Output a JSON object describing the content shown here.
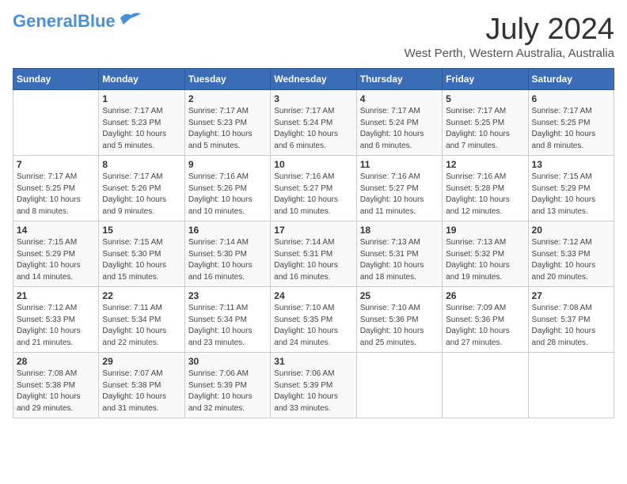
{
  "logo": {
    "text_general": "General",
    "text_blue": "Blue"
  },
  "title": "July 2024",
  "subtitle": "West Perth, Western Australia, Australia",
  "header_days": [
    "Sunday",
    "Monday",
    "Tuesday",
    "Wednesday",
    "Thursday",
    "Friday",
    "Saturday"
  ],
  "weeks": [
    [
      {
        "day": "",
        "info": ""
      },
      {
        "day": "1",
        "info": "Sunrise: 7:17 AM\nSunset: 5:23 PM\nDaylight: 10 hours\nand 5 minutes."
      },
      {
        "day": "2",
        "info": "Sunrise: 7:17 AM\nSunset: 5:23 PM\nDaylight: 10 hours\nand 5 minutes."
      },
      {
        "day": "3",
        "info": "Sunrise: 7:17 AM\nSunset: 5:24 PM\nDaylight: 10 hours\nand 6 minutes."
      },
      {
        "day": "4",
        "info": "Sunrise: 7:17 AM\nSunset: 5:24 PM\nDaylight: 10 hours\nand 6 minutes."
      },
      {
        "day": "5",
        "info": "Sunrise: 7:17 AM\nSunset: 5:25 PM\nDaylight: 10 hours\nand 7 minutes."
      },
      {
        "day": "6",
        "info": "Sunrise: 7:17 AM\nSunset: 5:25 PM\nDaylight: 10 hours\nand 8 minutes."
      }
    ],
    [
      {
        "day": "7",
        "info": "Sunrise: 7:17 AM\nSunset: 5:25 PM\nDaylight: 10 hours\nand 8 minutes."
      },
      {
        "day": "8",
        "info": "Sunrise: 7:17 AM\nSunset: 5:26 PM\nDaylight: 10 hours\nand 9 minutes."
      },
      {
        "day": "9",
        "info": "Sunrise: 7:16 AM\nSunset: 5:26 PM\nDaylight: 10 hours\nand 10 minutes."
      },
      {
        "day": "10",
        "info": "Sunrise: 7:16 AM\nSunset: 5:27 PM\nDaylight: 10 hours\nand 10 minutes."
      },
      {
        "day": "11",
        "info": "Sunrise: 7:16 AM\nSunset: 5:27 PM\nDaylight: 10 hours\nand 11 minutes."
      },
      {
        "day": "12",
        "info": "Sunrise: 7:16 AM\nSunset: 5:28 PM\nDaylight: 10 hours\nand 12 minutes."
      },
      {
        "day": "13",
        "info": "Sunrise: 7:15 AM\nSunset: 5:29 PM\nDaylight: 10 hours\nand 13 minutes."
      }
    ],
    [
      {
        "day": "14",
        "info": "Sunrise: 7:15 AM\nSunset: 5:29 PM\nDaylight: 10 hours\nand 14 minutes."
      },
      {
        "day": "15",
        "info": "Sunrise: 7:15 AM\nSunset: 5:30 PM\nDaylight: 10 hours\nand 15 minutes."
      },
      {
        "day": "16",
        "info": "Sunrise: 7:14 AM\nSunset: 5:30 PM\nDaylight: 10 hours\nand 16 minutes."
      },
      {
        "day": "17",
        "info": "Sunrise: 7:14 AM\nSunset: 5:31 PM\nDaylight: 10 hours\nand 16 minutes."
      },
      {
        "day": "18",
        "info": "Sunrise: 7:13 AM\nSunset: 5:31 PM\nDaylight: 10 hours\nand 18 minutes."
      },
      {
        "day": "19",
        "info": "Sunrise: 7:13 AM\nSunset: 5:32 PM\nDaylight: 10 hours\nand 19 minutes."
      },
      {
        "day": "20",
        "info": "Sunrise: 7:12 AM\nSunset: 5:33 PM\nDaylight: 10 hours\nand 20 minutes."
      }
    ],
    [
      {
        "day": "21",
        "info": "Sunrise: 7:12 AM\nSunset: 5:33 PM\nDaylight: 10 hours\nand 21 minutes."
      },
      {
        "day": "22",
        "info": "Sunrise: 7:11 AM\nSunset: 5:34 PM\nDaylight: 10 hours\nand 22 minutes."
      },
      {
        "day": "23",
        "info": "Sunrise: 7:11 AM\nSunset: 5:34 PM\nDaylight: 10 hours\nand 23 minutes."
      },
      {
        "day": "24",
        "info": "Sunrise: 7:10 AM\nSunset: 5:35 PM\nDaylight: 10 hours\nand 24 minutes."
      },
      {
        "day": "25",
        "info": "Sunrise: 7:10 AM\nSunset: 5:36 PM\nDaylight: 10 hours\nand 25 minutes."
      },
      {
        "day": "26",
        "info": "Sunrise: 7:09 AM\nSunset: 5:36 PM\nDaylight: 10 hours\nand 27 minutes."
      },
      {
        "day": "27",
        "info": "Sunrise: 7:08 AM\nSunset: 5:37 PM\nDaylight: 10 hours\nand 28 minutes."
      }
    ],
    [
      {
        "day": "28",
        "info": "Sunrise: 7:08 AM\nSunset: 5:38 PM\nDaylight: 10 hours\nand 29 minutes."
      },
      {
        "day": "29",
        "info": "Sunrise: 7:07 AM\nSunset: 5:38 PM\nDaylight: 10 hours\nand 31 minutes."
      },
      {
        "day": "30",
        "info": "Sunrise: 7:06 AM\nSunset: 5:39 PM\nDaylight: 10 hours\nand 32 minutes."
      },
      {
        "day": "31",
        "info": "Sunrise: 7:06 AM\nSunset: 5:39 PM\nDaylight: 10 hours\nand 33 minutes."
      },
      {
        "day": "",
        "info": ""
      },
      {
        "day": "",
        "info": ""
      },
      {
        "day": "",
        "info": ""
      }
    ]
  ]
}
